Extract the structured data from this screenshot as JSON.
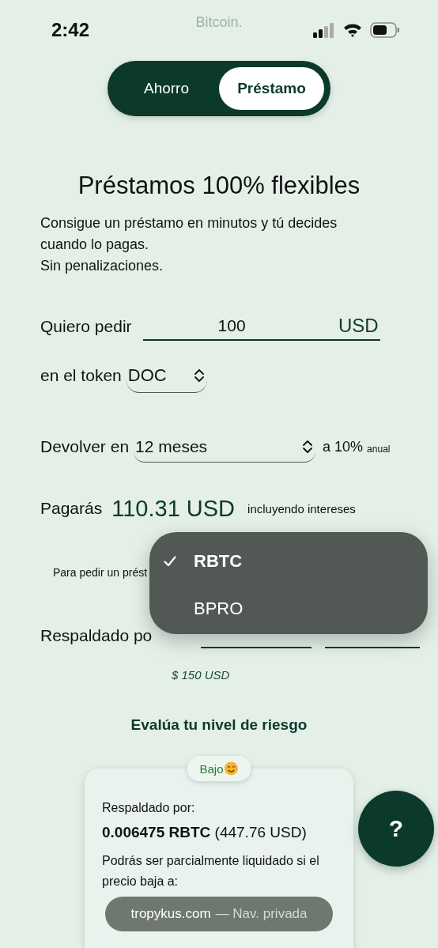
{
  "background_text": [
    "Bitcoin."
  ],
  "status_bar": {
    "time": "2:42"
  },
  "tabs": [
    {
      "label": "Ahorro",
      "selected": false
    },
    {
      "label": "Préstamo",
      "selected": true
    }
  ],
  "title": "Préstamos 100% flexibles",
  "description": [
    "Consigue un préstamo en minutos y tú decides cuando lo pagas.",
    "Sin penalizaciones."
  ],
  "amount": {
    "label": "Quiero pedir",
    "value": "100",
    "unit": "USD"
  },
  "token": {
    "label": "en el token",
    "value": "DOC"
  },
  "term": {
    "label": "Devolver en",
    "value": "12 meses",
    "rate": "a 10%",
    "rate_suffix": "anual"
  },
  "total": {
    "label": "Pagarás",
    "amount": "110.31 USD",
    "note": "incluyendo intereses"
  },
  "collateral_hint": "Para pedir un prést",
  "collateral": {
    "label": "Respaldado po",
    "usd_value": "$ 150 USD"
  },
  "risk": {
    "title": "Evalúa tu nivel de riesgo",
    "level": "Bajo",
    "backed_label": "Respaldado por:",
    "backed": "**0.006475 RBTC** (447.76 USD)",
    "liquidation_text": "Podrás ser parcialmente liquidado si el precio baja a:"
  },
  "dropdown_menu": {
    "options": [
      {
        "label": "RBTC",
        "selected": true
      },
      {
        "label": "BPRO",
        "selected": false
      }
    ]
  },
  "help_button": {
    "label": "?"
  },
  "address_bar": {
    "domain": "tropykus.com",
    "mode": "— Nav. privada"
  }
}
